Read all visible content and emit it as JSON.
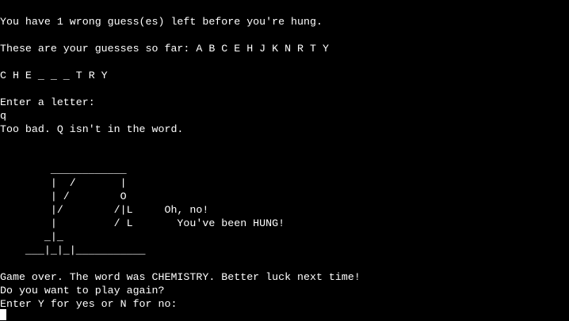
{
  "terminal": {
    "remaining_line": "You have 1 wrong guess(es) left before you're hung.",
    "guesses_line": "These are your guesses so far: A B C E H J K N R T Y",
    "word_line": "C H E _ _ _ T R Y",
    "prompt_line": "Enter a letter:",
    "input_line": "q",
    "feedback_line": "Too bad. Q isn't in the word.",
    "gallows": [
      "        ____________",
      "        |  /       |",
      "        | /        O",
      "        |/        /|L     Oh, no!",
      "        |         / L       You've been HUNG!",
      "       _|_",
      "    ___|_|_|___________"
    ],
    "game_over_line": "Game over. The word was CHEMISTRY. Better luck next time!",
    "play_again_line": "Do you want to play again?",
    "yn_prompt_line": "Enter Y for yes or N for no:"
  },
  "colors": {
    "background": "#000000",
    "text": "#ffffff"
  }
}
